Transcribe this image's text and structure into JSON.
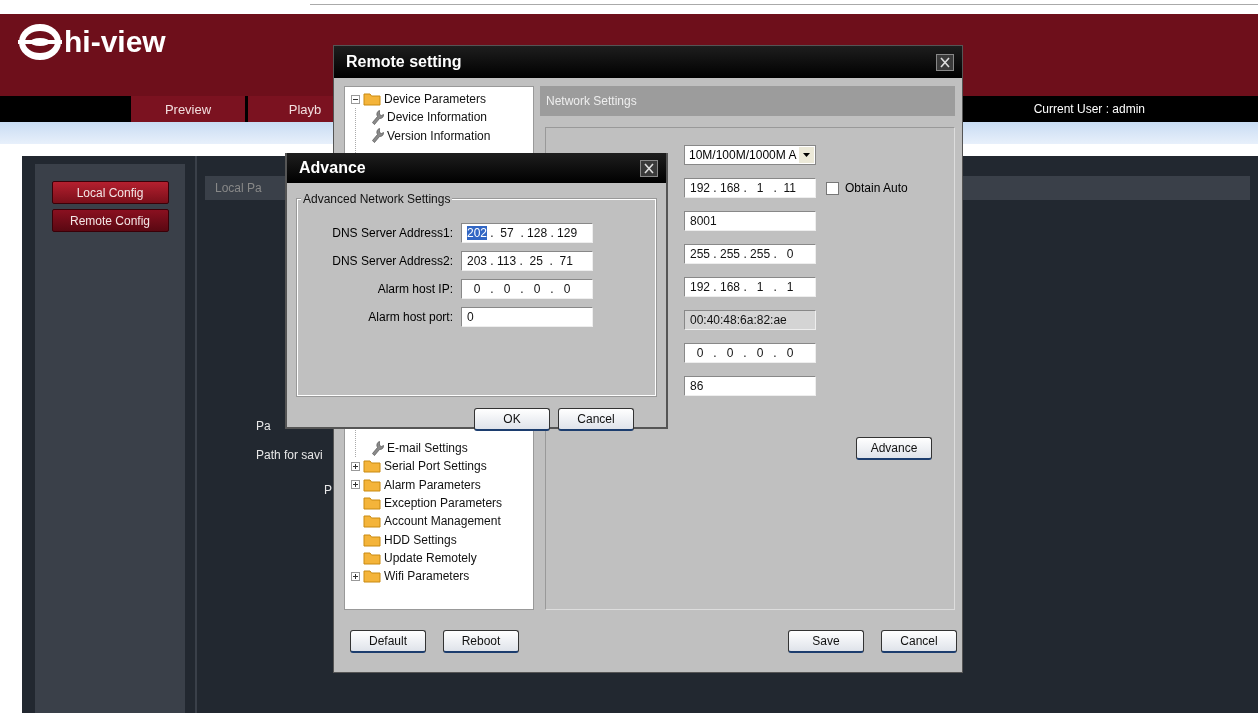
{
  "header": {
    "logo": "hi-view",
    "nav_tabs": [
      {
        "label": "Preview",
        "selected": false
      },
      {
        "label": "Playb",
        "selected": false
      }
    ],
    "current_user": "Current User : admin"
  },
  "sidebar": {
    "buttons": [
      {
        "label": "Local Config",
        "selected": false
      },
      {
        "label": "Remote Config",
        "selected": true
      }
    ]
  },
  "main": {
    "section_title": "Local Pa",
    "labels": [
      "Pa",
      "Path for savi",
      "P"
    ]
  },
  "remote_dialog": {
    "title": "Remote setting",
    "tree": [
      {
        "label": "Device Parameters",
        "kind": "expandable",
        "expanded": true,
        "children": [
          {
            "label": "Device Information"
          },
          {
            "label": "Version Information"
          },
          {
            "label": "E-mail Settings"
          }
        ]
      },
      {
        "label": "Serial Port Settings",
        "kind": "expandable",
        "expanded": false
      },
      {
        "label": "Alarm Parameters",
        "kind": "expandable",
        "expanded": false
      },
      {
        "label": "Exception Parameters",
        "kind": "plain"
      },
      {
        "label": "Account Management",
        "kind": "plain"
      },
      {
        "label": "HDD Settings",
        "kind": "plain"
      },
      {
        "label": "Update Remotely",
        "kind": "plain"
      },
      {
        "label": "Wifi Parameters",
        "kind": "expandable",
        "expanded": false
      }
    ],
    "panel_title": "Network Settings",
    "fields": [
      {
        "kind": "dropdown",
        "value": "10M/100M/1000M A",
        "disabled": false
      },
      {
        "kind": "text",
        "value": "192 . 168 .   1   .  11",
        "disabled": false,
        "checkbox": {
          "label": "Obtain Auto",
          "checked": false
        }
      },
      {
        "kind": "text",
        "value": "8001",
        "disabled": false
      },
      {
        "kind": "text",
        "value": "255 . 255 . 255 .   0",
        "disabled": false
      },
      {
        "kind": "text",
        "value": "192 . 168 .   1   .   1",
        "disabled": false
      },
      {
        "kind": "text",
        "value": "00:40:48:6a:82:ae",
        "disabled": true
      },
      {
        "kind": "text",
        "value": "  0   .   0   .   0   .   0",
        "disabled": false
      },
      {
        "kind": "text",
        "value": "86",
        "disabled": false
      }
    ],
    "advance_button": "Advance",
    "footer_left": [
      "Default",
      "Reboot"
    ],
    "footer_right": [
      "Save",
      "Cancel"
    ]
  },
  "advance_dialog": {
    "title": "Advance",
    "group_title": "Advanced Network Settings",
    "fields": [
      {
        "label": "DNS Server Address1:",
        "value_selected": "202",
        "value": " .  57  . 128 . 129"
      },
      {
        "label": "DNS Server Address2:",
        "value": "203 . 113 .  25  .  71"
      },
      {
        "label": "Alarm host IP:",
        "value": "  0   .   0   .   0   .   0"
      },
      {
        "label": "Alarm host port:",
        "value": "0"
      }
    ],
    "buttons": [
      "OK",
      "Cancel"
    ]
  }
}
